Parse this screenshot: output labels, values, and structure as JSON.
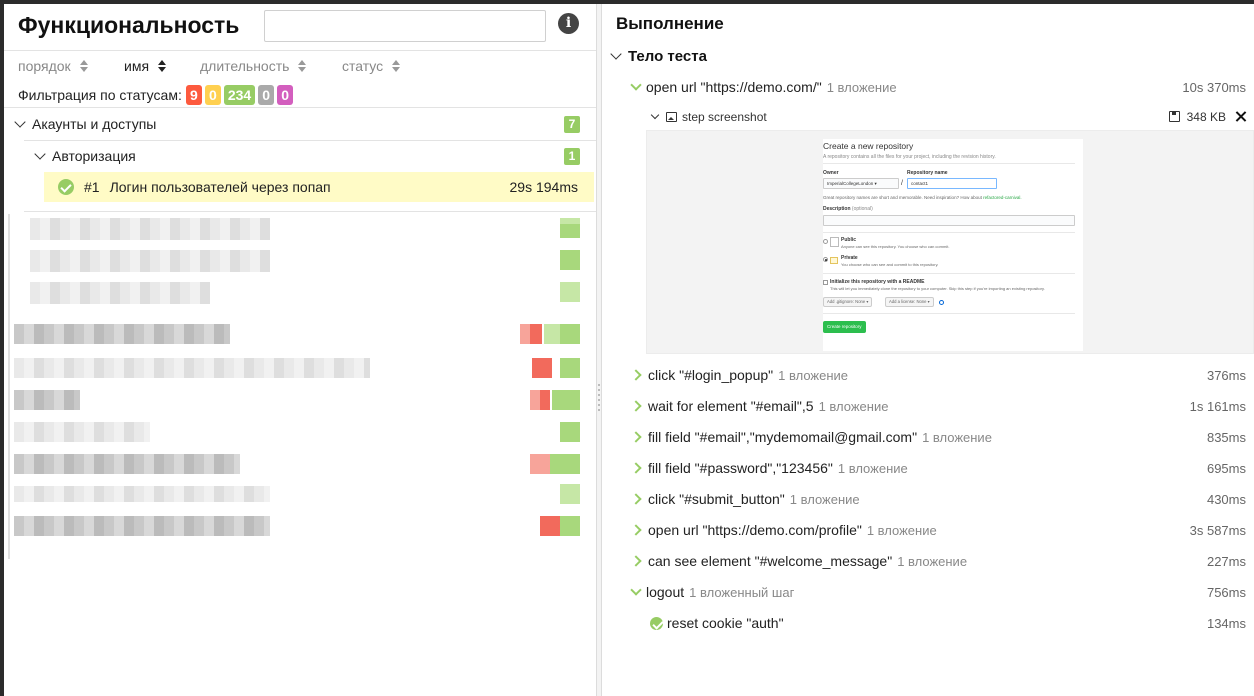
{
  "left": {
    "title": "Функциональность",
    "search": {
      "value": "",
      "placeholder": ""
    },
    "info_icon": "info-icon",
    "sort": {
      "order": "порядок",
      "name": "имя",
      "duration": "длительность",
      "status": "статус"
    },
    "filter": {
      "label": "Фильтрация по статусам:",
      "badges": [
        {
          "value": "9",
          "color": "#fd5a3e"
        },
        {
          "value": "0",
          "color": "#ffd050"
        },
        {
          "value": "234",
          "color": "#97cc64"
        },
        {
          "value": "0",
          "color": "#aaaaaa"
        },
        {
          "value": "0",
          "color": "#d35ebe"
        }
      ]
    },
    "tree": {
      "group": {
        "label": "Акаунты и доступы",
        "count": "7"
      },
      "subgroup": {
        "label": "Авторизация",
        "count": "1"
      },
      "test": {
        "number": "#1",
        "label": "Логин пользователей через попап",
        "duration": "29s 194ms"
      }
    }
  },
  "right": {
    "title": "Выполнение",
    "section": "Тело теста",
    "steps": [
      {
        "name": "open url \"https://demo.com/\"",
        "meta": "1 вложение",
        "duration": "10s 370ms"
      },
      {
        "name": "click \"#login_popup\"",
        "meta": "1 вложение",
        "duration": "376ms"
      },
      {
        "name": "wait for element \"#email\",5",
        "meta": "1 вложение",
        "duration": "1s 161ms"
      },
      {
        "name": "fill field \"#email\",\"mydemomail@gmail.com\"",
        "meta": "1 вложение",
        "duration": "835ms"
      },
      {
        "name": "fill field \"#password\",\"123456\"",
        "meta": "1 вложение",
        "duration": "695ms"
      },
      {
        "name": "click \"#submit_button\"",
        "meta": "1 вложение",
        "duration": "430ms"
      },
      {
        "name": "open url \"https://demo.com/profile\"",
        "meta": "1 вложение",
        "duration": "3s 587ms"
      },
      {
        "name": "can see element \"#welcome_message\"",
        "meta": "1 вложение",
        "duration": "227ms"
      },
      {
        "name": "logout",
        "meta": "1 вложенный шаг",
        "duration": "756ms"
      }
    ],
    "substep": {
      "name": "reset cookie \"auth\"",
      "duration": "134ms"
    },
    "attachment": {
      "name": "step screenshot",
      "size": "348 KB"
    },
    "screenshot": {
      "heading": "Create a new repository",
      "subheading": "A repository contains all the files for your project, including the revision history.",
      "owner_label": "Owner",
      "owner_value": "ImperialCollegeLondon ▾",
      "slash": "/",
      "repo_label": "Repository name",
      "repo_value": "contact1",
      "hint": "Great repository names are short and memorable. Need inspiration? How about",
      "hint_link": "refactored-carnival.",
      "desc_label": "Description",
      "desc_optional": "(optional)",
      "public_label": "Public",
      "public_desc": "Anyone can see this repository. You choose who can commit.",
      "private_label": "Private",
      "private_desc": "You choose who can see and commit to this repository.",
      "init_label": "Initialize this repository with a README",
      "init_desc": "This will let you immediately clone the repository to your computer. Skip this step if you're importing an existing repository.",
      "gitignore": "Add .gitignore: None ▾",
      "license": "Add a license: None ▾",
      "create_btn": "Create repository"
    }
  }
}
